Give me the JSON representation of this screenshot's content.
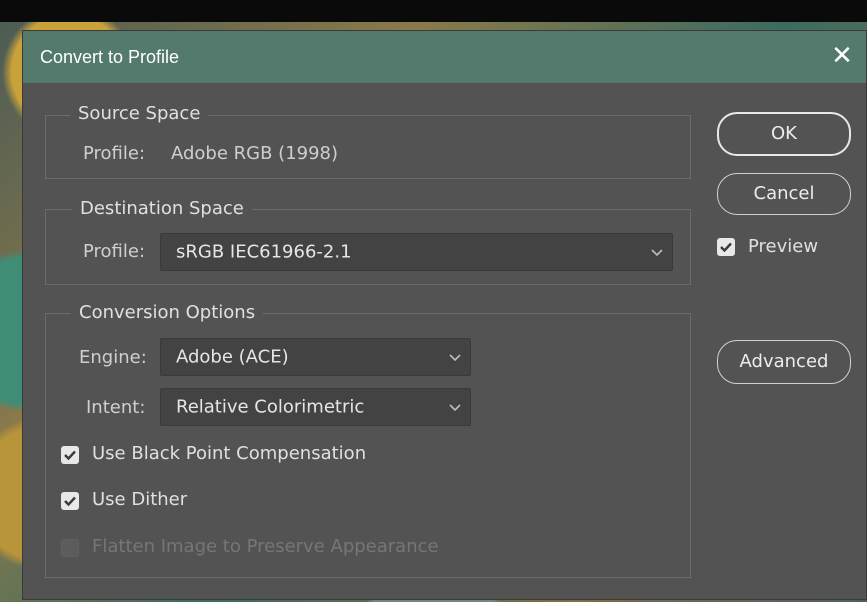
{
  "dialog": {
    "title": "Convert to Profile"
  },
  "source_space": {
    "legend": "Source Space",
    "profile_label": "Profile:",
    "profile_value": "Adobe RGB (1998)"
  },
  "destination_space": {
    "legend": "Destination Space",
    "profile_label": "Profile:",
    "profile_value": "sRGB IEC61966-2.1"
  },
  "conversion_options": {
    "legend": "Conversion Options",
    "engine_label": "Engine:",
    "engine_value": "Adobe (ACE)",
    "intent_label": "Intent:",
    "intent_value": "Relative Colorimetric",
    "black_point_label": "Use Black Point Compensation",
    "black_point_checked": true,
    "dither_label": "Use Dither",
    "dither_checked": true,
    "flatten_label": "Flatten Image to Preserve Appearance",
    "flatten_checked": false,
    "flatten_enabled": false
  },
  "buttons": {
    "ok": "OK",
    "cancel": "Cancel",
    "advanced": "Advanced"
  },
  "preview": {
    "label": "Preview",
    "checked": true
  },
  "colors": {
    "titlebar": "#537a6d",
    "dialog_bg": "#535353",
    "field_bg": "#434343"
  },
  "icons": {
    "close": "close-icon",
    "dropdown": "chevron-down-icon",
    "check": "checkmark-icon"
  }
}
